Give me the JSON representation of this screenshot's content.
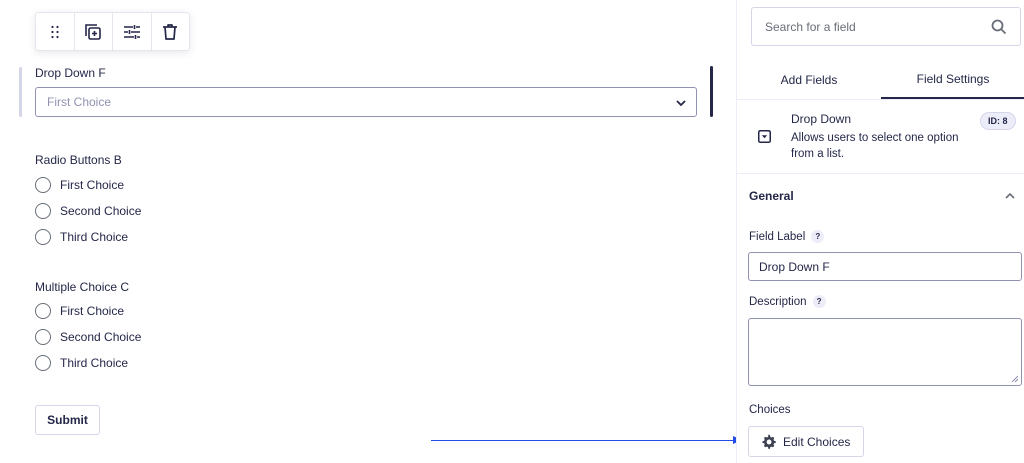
{
  "toolbar": {
    "icons": [
      "drag-handle-icon",
      "duplicate-icon",
      "settings-sliders-icon",
      "trash-icon"
    ]
  },
  "form": {
    "dropdown": {
      "label": "Drop Down F",
      "placeholder": "First Choice"
    },
    "radio_group": {
      "label": "Radio Buttons B",
      "options": [
        "First Choice",
        "Second Choice",
        "Third Choice"
      ]
    },
    "multiple_choice": {
      "label": "Multiple Choice C",
      "options": [
        "First Choice",
        "Second Choice",
        "Third Choice"
      ]
    },
    "submit_label": "Submit"
  },
  "sidebar": {
    "search_placeholder": "Search for a field",
    "tabs": [
      {
        "label": "Add Fields",
        "active": false
      },
      {
        "label": "Field Settings",
        "active": true
      }
    ],
    "field_info": {
      "title": "Drop Down",
      "description": "Allows users to select one option from a list.",
      "id_badge": "ID: 8"
    },
    "section": {
      "title": "General"
    },
    "field_label": {
      "label": "Field Label",
      "help": "?",
      "value": "Drop Down F"
    },
    "description": {
      "label": "Description",
      "help": "?",
      "value": ""
    },
    "choices": {
      "label": "Choices",
      "button_label": "Edit Choices"
    }
  },
  "colors": {
    "text": "#242748",
    "accent_arrow": "#204ce5",
    "border": "#9092b2",
    "muted": "#686e77"
  }
}
